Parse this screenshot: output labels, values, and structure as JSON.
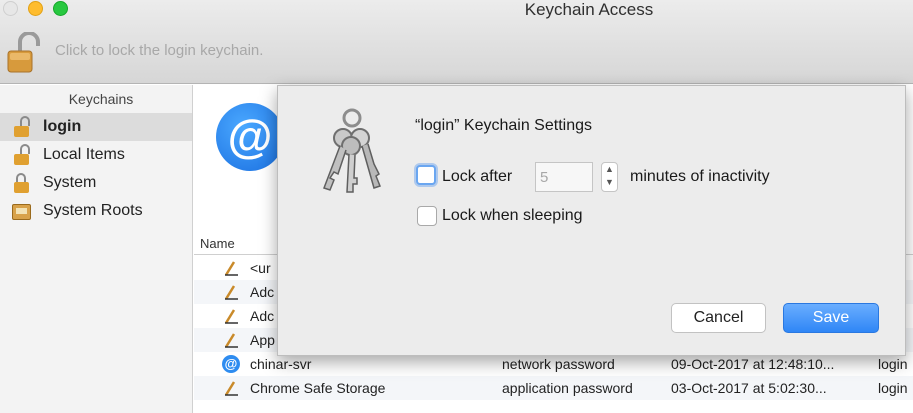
{
  "window": {
    "title": "Keychain Access",
    "lock_hint": "Click to lock the login keychain."
  },
  "sidebar": {
    "header": "Keychains",
    "items": [
      {
        "label": "login",
        "icon": "padlock-open-icon",
        "selected": true
      },
      {
        "label": "Local Items",
        "icon": "padlock-open-icon"
      },
      {
        "label": "System",
        "icon": "padlock-icon"
      },
      {
        "label": "System Roots",
        "icon": "cabinet-icon"
      }
    ]
  },
  "list": {
    "column_name": "Name",
    "rows": [
      {
        "name": "<ur",
        "kind": "",
        "date": "",
        "keychain": "",
        "icon": "password-pen-icon"
      },
      {
        "name": "Adc",
        "kind": "",
        "date": "",
        "keychain": "",
        "icon": "password-pen-icon"
      },
      {
        "name": "Adc",
        "kind": "",
        "date": "",
        "keychain": "",
        "icon": "password-pen-icon"
      },
      {
        "name": "App",
        "kind": "",
        "date": "",
        "keychain": "",
        "icon": "password-pen-icon"
      },
      {
        "name": "chinar-svr",
        "kind": "network password",
        "date": "09-Oct-2017 at 12:48:10...",
        "keychain": "login",
        "icon": "at-icon"
      },
      {
        "name": "Chrome Safe Storage",
        "kind": "application password",
        "date": "03-Oct-2017 at 5:02:30...",
        "keychain": "login",
        "icon": "password-pen-icon"
      }
    ]
  },
  "dialog": {
    "title": "“login” Keychain Settings",
    "lock_after_label": "Lock after",
    "minutes_value": "5",
    "minutes_suffix": "minutes of inactivity",
    "lock_sleep_label": "Lock when sleeping",
    "cancel_label": "Cancel",
    "save_label": "Save",
    "lock_after_checked": false,
    "lock_sleep_checked": false
  },
  "colors": {
    "accent": "#2f86f6",
    "padlock": "#e0a030"
  }
}
